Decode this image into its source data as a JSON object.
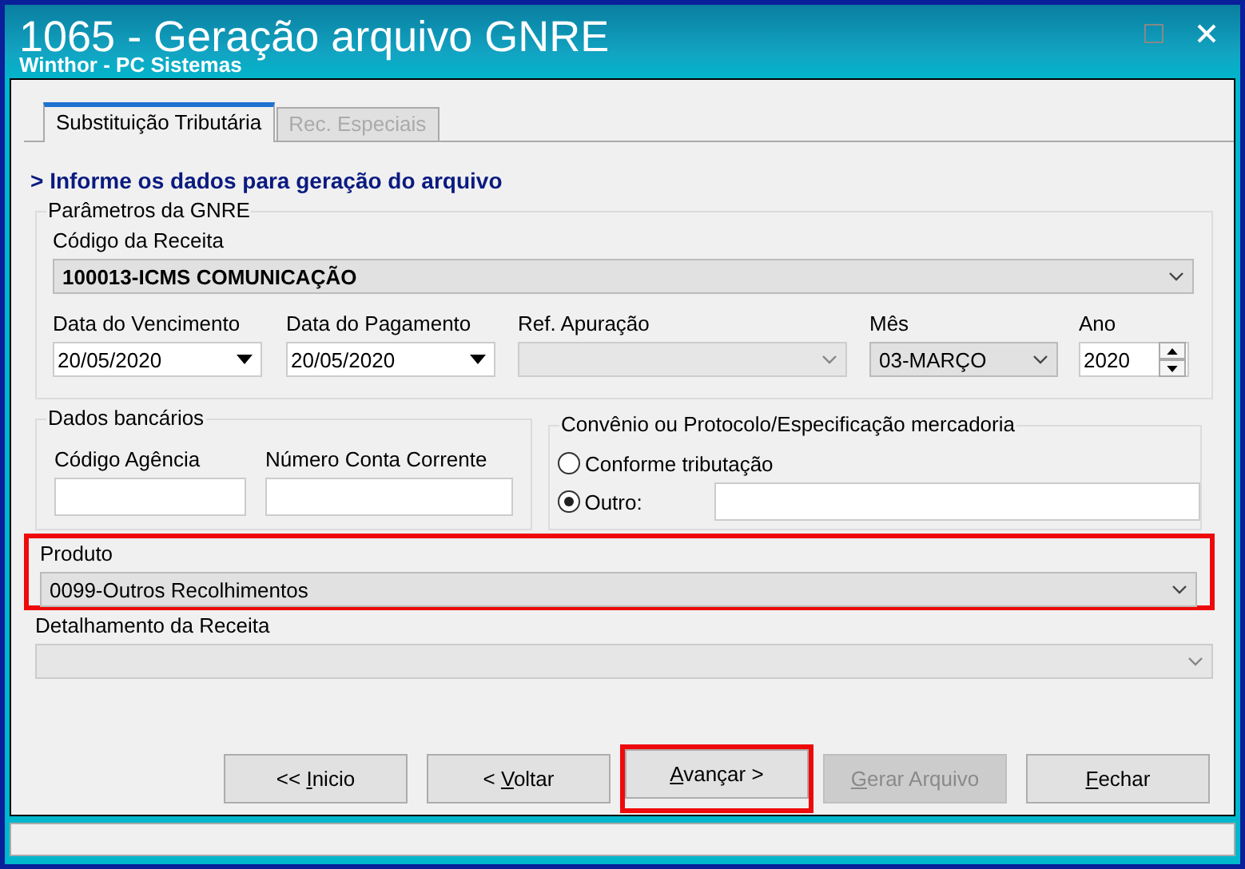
{
  "window": {
    "title": "1065 - Geração arquivo GNRE",
    "subtitle": "Winthor - PC Sistemas"
  },
  "tabs": [
    {
      "label": "Substituição Tributária",
      "selected": true
    },
    {
      "label": "Rec. Especiais",
      "selected": false
    }
  ],
  "heading": "> Informe os dados para geração do arquivo",
  "parametros": {
    "title": "Parâmetros da GNRE",
    "codigo_receita": {
      "label": "Código da Receita",
      "value": "100013-ICMS COMUNICAÇÃO"
    },
    "fields": [
      {
        "kind": "date",
        "label": "Data do Vencimento",
        "value": "20/05/2020"
      },
      {
        "kind": "date",
        "label": "Data do Pagamento",
        "value": "20/05/2020"
      },
      {
        "kind": "combo",
        "label": "Ref. Apuração",
        "disabled": true
      },
      {
        "kind": "combo",
        "label": "Mês",
        "value": "03-MARÇO",
        "disabled": false
      },
      {
        "kind": "spin",
        "label": "Ano",
        "value": "2020"
      }
    ]
  },
  "dados_bancarios": {
    "title": "Dados bancários",
    "fields": [
      {
        "label": "Código Agência"
      },
      {
        "label": "Número Conta Corrente"
      }
    ]
  },
  "convenio": {
    "title": "Convênio ou Protocolo/Especificação mercadoria",
    "options": [
      {
        "label": "Conforme tributação",
        "selected": false
      },
      {
        "label": "Outro:",
        "selected": true
      }
    ]
  },
  "produto": {
    "label": "Produto",
    "value": "0099-Outros Recolhimentos",
    "highlighted": true
  },
  "detalhamento": {
    "label": "Detalhamento da Receita",
    "disabled": true
  },
  "buttons": [
    {
      "before": "<<  ",
      "key": "I",
      "after": "nicio",
      "disabled": false,
      "highlighted": false
    },
    {
      "before": "<  ",
      "key": "V",
      "after": "oltar",
      "disabled": false,
      "highlighted": false
    },
    {
      "key": "A",
      "after": "vançar >",
      "disabled": false,
      "highlighted": true
    },
    {
      "key": "G",
      "after": "erar Arquivo",
      "disabled": true,
      "highlighted": false
    },
    {
      "key": "F",
      "after": "echar",
      "disabled": false,
      "highlighted": false
    }
  ]
}
